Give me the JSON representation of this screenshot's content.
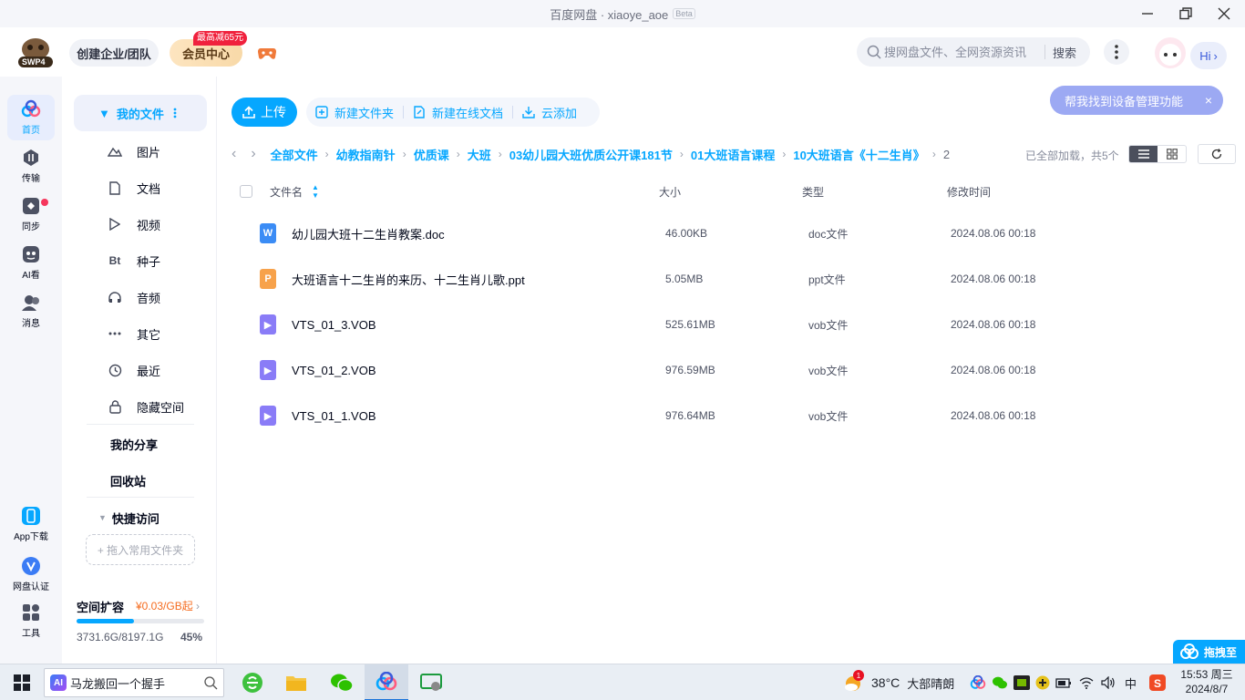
{
  "window": {
    "title": "百度网盘 · xiaoye_aoe",
    "beta": "Beta"
  },
  "topbar": {
    "logo_text": "SWP4",
    "create_team": "创建企业/团队",
    "vip_center": "会员中心",
    "vip_badge": "最高减65元",
    "search_placeholder": "搜网盘文件、全网资源资讯",
    "search_button": "搜索",
    "hi": "Hi"
  },
  "leftnav": [
    {
      "label": "首页",
      "icon": "home-cloud-icon"
    },
    {
      "label": "传输",
      "icon": "transfer-icon"
    },
    {
      "label": "同步",
      "icon": "sync-icon"
    },
    {
      "label": "AI看",
      "icon": "ai-view-icon"
    },
    {
      "label": "消息",
      "icon": "message-icon"
    },
    {
      "label": "App下载",
      "icon": "app-download-icon"
    },
    {
      "label": "网盘认证",
      "icon": "verify-icon"
    },
    {
      "label": "工具",
      "icon": "tools-icon"
    }
  ],
  "sidebar": {
    "my_files": "我的文件",
    "categories": [
      {
        "label": "图片",
        "icon": "image-icon"
      },
      {
        "label": "文档",
        "icon": "document-icon"
      },
      {
        "label": "视频",
        "icon": "video-icon"
      },
      {
        "label": "种子",
        "icon": "torrent-icon",
        "glyph": "Bt"
      },
      {
        "label": "音频",
        "icon": "headphone-icon"
      },
      {
        "label": "其它",
        "icon": "more-dots-icon"
      },
      {
        "label": "最近",
        "icon": "clock-icon"
      },
      {
        "label": "隐藏空间",
        "icon": "lock-icon"
      }
    ],
    "my_share": "我的分享",
    "recycle": "回收站",
    "quick_access": "快捷访问",
    "drop_hint": "+ 拖入常用文件夹",
    "space": {
      "title": "空间扩容",
      "price": "¥0.03/GB起",
      "used_text": "3731.6G/8197.1G",
      "percent_text": "45%",
      "percent": 45
    }
  },
  "toolbar": {
    "upload": "上传",
    "new_folder": "新建文件夹",
    "new_online_doc": "新建在线文档",
    "cloud_add": "云添加",
    "tip": "帮我找到设备管理功能"
  },
  "breadcrumb": {
    "items": [
      "全部文件",
      "幼教指南针",
      "优质课",
      "大班",
      "03幼儿园大班优质公开课181节",
      "01大班语言课程",
      "10大班语言《十二生肖》"
    ],
    "current": "2",
    "loaded": "已全部加载，共5个"
  },
  "table": {
    "headers": {
      "name": "文件名",
      "size": "大小",
      "type": "类型",
      "modified": "修改时间"
    },
    "rows": [
      {
        "name": "幼儿园大班十二生肖教案.doc",
        "size": "46.00KB",
        "type": "doc文件",
        "modified": "2024.08.06 00:18",
        "kind": "doc",
        "glyph": "W",
        "color": "#3b8cf5"
      },
      {
        "name": "大班语言十二生肖的来历、十二生肖儿歌.ppt",
        "size": "5.05MB",
        "type": "ppt文件",
        "modified": "2024.08.06 00:18",
        "kind": "ppt",
        "glyph": "P",
        "color": "#f7a24b"
      },
      {
        "name": "VTS_01_3.VOB",
        "size": "525.61MB",
        "type": "vob文件",
        "modified": "2024.08.06 00:18",
        "kind": "video",
        "glyph": "▶",
        "color": "#8a7cf7"
      },
      {
        "name": "VTS_01_2.VOB",
        "size": "976.59MB",
        "type": "vob文件",
        "modified": "2024.08.06 00:18",
        "kind": "video",
        "glyph": "▶",
        "color": "#8a7cf7"
      },
      {
        "name": "VTS_01_1.VOB",
        "size": "976.64MB",
        "type": "vob文件",
        "modified": "2024.08.06 00:18",
        "kind": "video",
        "glyph": "▶",
        "color": "#8a7cf7"
      }
    ]
  },
  "drag_tab": "拖拽至",
  "taskbar": {
    "search_value": "马龙搬回一个握手",
    "ai_badge": "AI",
    "weather_temp": "38°C",
    "weather_text": "大部晴朗",
    "weather_badge": "1",
    "ime": "中",
    "time": "15:53 周三",
    "date": "2024/8/7"
  },
  "colors": {
    "accent": "#06a7ff",
    "tip": "#9ca9f3",
    "sidebar_bg": "#f5f6fa"
  }
}
